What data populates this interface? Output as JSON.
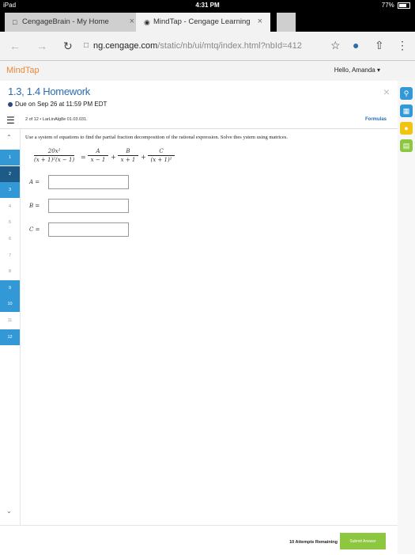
{
  "status_bar": {
    "device": "iPad",
    "time": "4:31 PM",
    "battery": "77%"
  },
  "tabs": [
    {
      "label": "CengageBrain - My Home",
      "active": false
    },
    {
      "label": "MindTap - Cengage Learning",
      "active": true
    }
  ],
  "address": {
    "host": "ng.cengage.com",
    "path": "/static/nb/ui/mtq/index.html?nbId=412"
  },
  "app": {
    "logo": "MindTap",
    "greeting": "Hello, Amanda ▾"
  },
  "assignment": {
    "title": "1.3, 1.4 Homework",
    "due": "Due on Sep 26 at 11:59 PM EDT",
    "position": "2 of 12 • LarLinAlg8e 01.03.031.",
    "formulas_label": "Formulas"
  },
  "question_nav": [
    {
      "n": "1",
      "state": "done"
    },
    {
      "n": "2",
      "state": "current"
    },
    {
      "n": "3",
      "state": "done"
    },
    {
      "n": "4",
      "state": "none"
    },
    {
      "n": "5",
      "state": "none"
    },
    {
      "n": "6",
      "state": "none"
    },
    {
      "n": "7",
      "state": "none"
    },
    {
      "n": "8",
      "state": "none"
    },
    {
      "n": "9",
      "state": "done"
    },
    {
      "n": "10",
      "state": "done"
    },
    {
      "n": "11",
      "state": "none"
    },
    {
      "n": "12",
      "state": "done"
    }
  ],
  "question": {
    "instruction": "Use a system of equations to find the partial fraction decomposition of the rational expression. Solve thes ystem using matrices.",
    "lhs_num": "20x²",
    "lhs_den": "(x + 1)²(x − 1)",
    "t1_num": "A",
    "t1_den": "x − 1",
    "t2_num": "B",
    "t2_den": "x + 1",
    "t3_num": "C",
    "t3_den": "(x + 1)²",
    "answers": [
      {
        "label": "A =",
        "value": ""
      },
      {
        "label": "B =",
        "value": ""
      },
      {
        "label": "C =",
        "value": ""
      }
    ]
  },
  "footer": {
    "attempts": "10 Attempts Remaining",
    "submit": "Submit Answer"
  },
  "colors": {
    "accent_blue": "#3399d6",
    "current_dark": "#1d5a87",
    "submit_green": "#8dc63f",
    "logo_orange": "#e8883a"
  }
}
